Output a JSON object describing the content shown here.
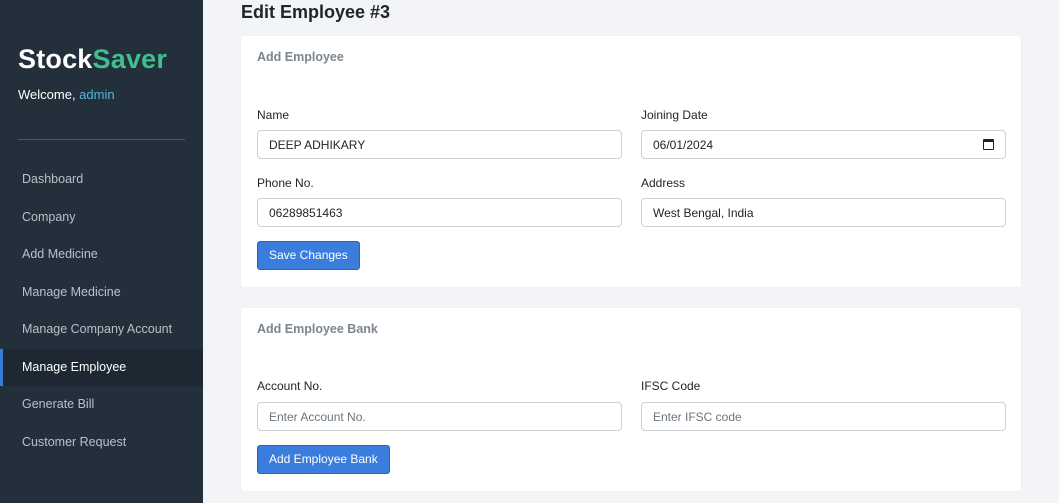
{
  "brand": {
    "part1": "Stock",
    "part2": "Saver"
  },
  "welcome": {
    "prefix": "Welcome, ",
    "user": "admin"
  },
  "nav": {
    "items": [
      {
        "label": "Dashboard"
      },
      {
        "label": "Company"
      },
      {
        "label": "Add Medicine"
      },
      {
        "label": "Manage Medicine"
      },
      {
        "label": "Manage Company Account"
      },
      {
        "label": "Manage Employee",
        "active": true
      },
      {
        "label": "Generate Bill"
      },
      {
        "label": "Customer Request"
      }
    ]
  },
  "page": {
    "title": "Edit Employee #3"
  },
  "employee_form": {
    "title": "Add Employee",
    "name_label": "Name",
    "name_value": "DEEP ADHIKARY",
    "joining_label": "Joining Date",
    "joining_value": "06/01/2024",
    "phone_label": "Phone No.",
    "phone_value": "06289851463",
    "address_label": "Address",
    "address_value": "West Bengal, India",
    "save_label": "Save Changes"
  },
  "bank_form": {
    "title": "Add Employee Bank",
    "account_label": "Account No.",
    "account_placeholder": "Enter Account No.",
    "ifsc_label": "IFSC Code",
    "ifsc_placeholder": "Enter IFSC code",
    "submit_label": "Add Employee Bank"
  },
  "icons": {
    "calendar": "calendar-icon"
  },
  "colors": {
    "sidebar_bg": "#232f3a",
    "brand_accent": "#3fc08c",
    "primary": "#3b7ddd",
    "user_link": "#55b6dc"
  }
}
